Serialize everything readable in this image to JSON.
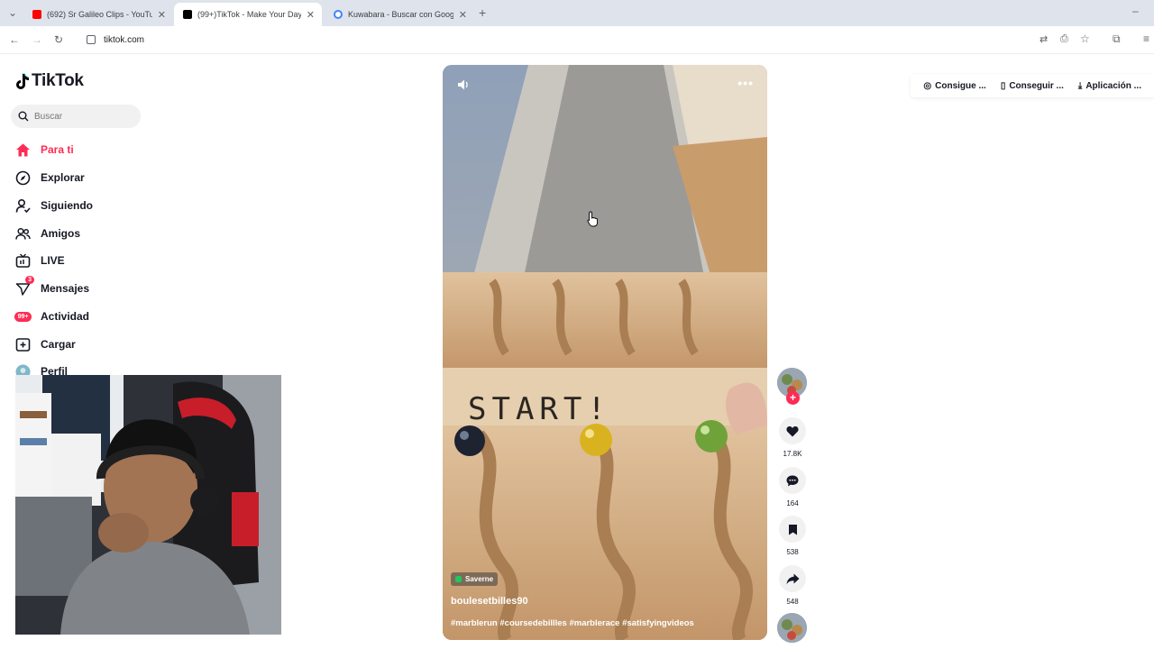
{
  "browser": {
    "tabs": [
      {
        "title": "(692) Sr Galileo Clips - YouTube",
        "active": false
      },
      {
        "title": "(99+)TikTok - Make Your Day",
        "active": true
      },
      {
        "title": "Kuwabara - Buscar con Google",
        "active": false
      }
    ],
    "url": "tiktok.com"
  },
  "sidebar": {
    "brand": "TikTok",
    "search_placeholder": "Buscar",
    "items": [
      {
        "label": "Para ti",
        "icon": "home-icon"
      },
      {
        "label": "Explorar",
        "icon": "compass-icon"
      },
      {
        "label": "Siguiendo",
        "icon": "following-icon"
      },
      {
        "label": "Amigos",
        "icon": "friends-icon"
      },
      {
        "label": "LIVE",
        "icon": "live-icon"
      },
      {
        "label": "Mensajes",
        "icon": "messages-icon",
        "badge": "3"
      },
      {
        "label": "Actividad",
        "icon": "activity-icon",
        "badge": "99+"
      },
      {
        "label": "Cargar",
        "icon": "upload-icon"
      },
      {
        "label": "Perfil",
        "icon": "profile-avatar"
      }
    ]
  },
  "video": {
    "location": "Saverne",
    "author": "boulesetbilles90",
    "caption": "#marblerun #coursedebillles #marblerace #satisfyingvideos",
    "sign_text": "START!"
  },
  "actions": {
    "likes": "17.8K",
    "comments": "164",
    "saves": "538",
    "shares": "548"
  },
  "top_links": [
    {
      "label": "Consigue ...",
      "icon": "coin-icon"
    },
    {
      "label": "Conseguir ...",
      "icon": "phone-icon"
    },
    {
      "label": "Aplicación ...",
      "icon": "download-icon"
    }
  ],
  "colors": {
    "accent": "#fe2c55",
    "text": "#161823"
  }
}
